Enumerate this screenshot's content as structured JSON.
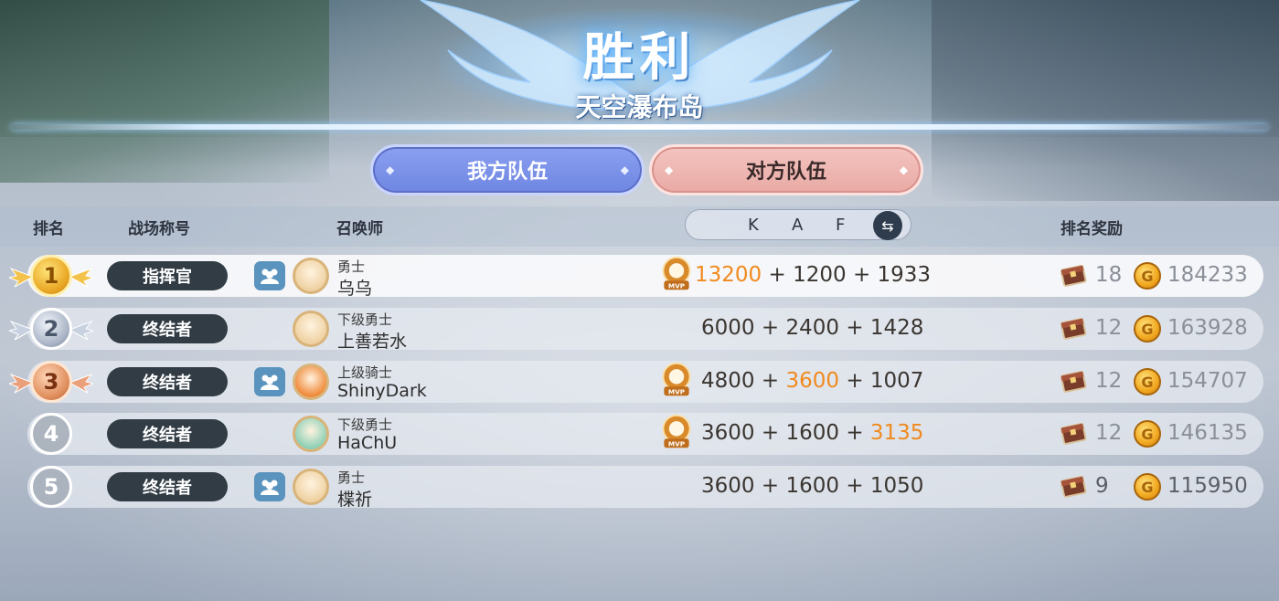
{
  "banner": {
    "title": "胜利",
    "map": "天空瀑布岛"
  },
  "tabs": {
    "ours": "我方队伍",
    "theirs": "对方队伍"
  },
  "headers": {
    "rank": "排名",
    "battle_title": "战场称号",
    "summoner": "召唤师",
    "k": "K",
    "a": "A",
    "f": "F",
    "reward": "排名奖励"
  },
  "rows": [
    {
      "rank": "1",
      "title": "指挥官",
      "party": true,
      "grade": "勇士",
      "name": "乌乌",
      "mvp": true,
      "k": "13200",
      "a": "1200",
      "f": "1933",
      "highlight": "k",
      "box": "18",
      "coin": "184233"
    },
    {
      "rank": "2",
      "title": "终结者",
      "party": false,
      "grade": "下级勇士",
      "name": "上善若水",
      "mvp": false,
      "k": "6000",
      "a": "2400",
      "f": "1428",
      "highlight": "",
      "box": "12",
      "coin": "163928"
    },
    {
      "rank": "3",
      "title": "终结者",
      "party": true,
      "grade": "上级骑士",
      "name": "ShinyDark",
      "mvp": true,
      "k": "4800",
      "a": "3600",
      "f": "1007",
      "highlight": "a",
      "box": "12",
      "coin": "154707"
    },
    {
      "rank": "4",
      "title": "终结者",
      "party": false,
      "grade": "下级勇士",
      "name": "HaChU",
      "mvp": true,
      "k": "3600",
      "a": "1600",
      "f": "3135",
      "highlight": "f",
      "box": "12",
      "coin": "146135"
    },
    {
      "rank": "5",
      "title": "终结者",
      "party": true,
      "grade": "勇士",
      "name": "楪祈",
      "mvp": false,
      "k": "3600",
      "a": "1600",
      "f": "1050",
      "highlight": "",
      "box": "9",
      "coin": "115950"
    }
  ],
  "symbols": {
    "plus": "+",
    "coin_glyph": "G",
    "mvp_label": "MVP",
    "swap_glyph": "⇆"
  },
  "colors": {
    "highlight": "#f08a1e",
    "ours_tab": "#7a8fe8",
    "theirs_tab": "#eeb6b1",
    "title_pill": "#313c45"
  },
  "icons": {
    "party": "party-members-icon",
    "box": "treasure-chest-icon",
    "coin": "gold-coin-icon",
    "mvp": "mvp-badge-icon",
    "swap": "swap-arrows-icon"
  }
}
